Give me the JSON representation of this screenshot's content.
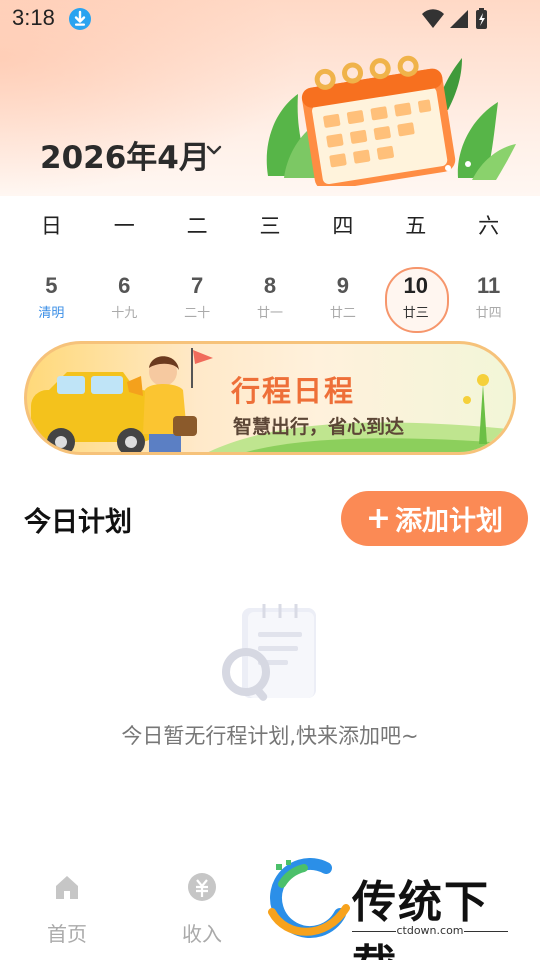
{
  "status_bar": {
    "time": "3:18"
  },
  "header": {
    "month_label": "2026年4月"
  },
  "week_days": [
    "日",
    "一",
    "二",
    "三",
    "四",
    "五",
    "六"
  ],
  "dates": [
    {
      "day": "5",
      "lunar": "清明"
    },
    {
      "day": "6",
      "lunar": "十九"
    },
    {
      "day": "7",
      "lunar": "二十"
    },
    {
      "day": "8",
      "lunar": "廿一"
    },
    {
      "day": "9",
      "lunar": "廿二"
    },
    {
      "day": "10",
      "lunar": "廿三",
      "selected": true
    },
    {
      "day": "11",
      "lunar": "廿四"
    }
  ],
  "banner": {
    "title": "行程日程",
    "subtitle": "智慧出行，省心到达"
  },
  "plan": {
    "title": "今日计划",
    "add_button": "添加计划",
    "add_icon": "+",
    "empty_text": "今日暂无行程计划,快来添加吧~"
  },
  "nav": [
    {
      "label": "首页",
      "icon": "home-icon"
    },
    {
      "label": "收入",
      "icon": "income-icon"
    }
  ],
  "watermark": {
    "brand": "传统下载",
    "url": "ctdown.com"
  },
  "colors": {
    "accent": "#fb8a55",
    "banner_title": "#ee6f38",
    "solar_term": "#3a8ee6",
    "selected_ring": "#f6966c"
  }
}
